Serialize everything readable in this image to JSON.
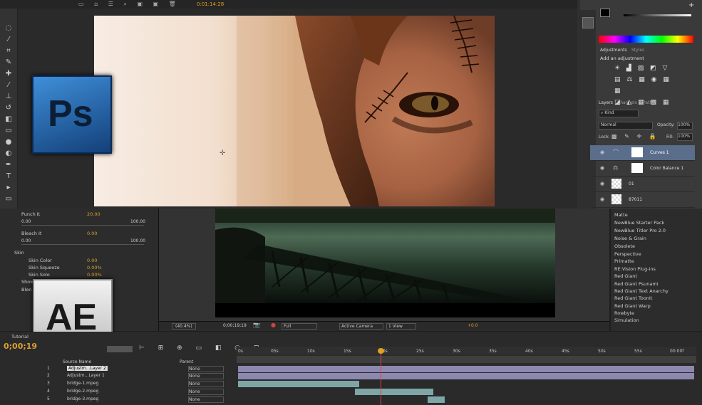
{
  "photoshop": {
    "logo": "Ps",
    "timecode": "0:01:14:28",
    "panels": {
      "adjustments_tab": "Adjustments",
      "styles_tab": "Styles",
      "add_adjustment": "Add an adjustment",
      "layers_tab": "Layers",
      "channels_tab": "Channels",
      "paths_tab": "Paths",
      "kind": "Kind",
      "blend_mode": "Normal",
      "opacity_label": "Opacity:",
      "opacity_value": "100%",
      "lock_label": "Lock:",
      "fill_label": "Fill:",
      "fill_value": "100%"
    },
    "layers": [
      {
        "name": "Curves 1"
      },
      {
        "name": "Color Balance 1"
      },
      {
        "name": "01"
      },
      {
        "name": "87011"
      }
    ]
  },
  "after_effects": {
    "logo": "AE",
    "effect_controls": {
      "punch_it": {
        "label": "Punch It",
        "value": "20.00",
        "min": "0.00",
        "max": "100.00"
      },
      "bleach_it": {
        "label": "Bleach It",
        "value": "0.00",
        "min": "0.00",
        "max": "100.00"
      },
      "skin": "Skin",
      "skin_color": {
        "label": "Skin Color",
        "value": "0.00"
      },
      "skin_squeeze": {
        "label": "Skin Squeeze",
        "value": "0.00%"
      },
      "skin_solo": {
        "label": "Skin Solo",
        "value": "0.00%"
      },
      "show": "Show",
      "blend": "Blen"
    },
    "viewer": {
      "zoom": "(40.4%)",
      "timecode": "0;00;19;19",
      "resolution": "Full",
      "camera": "Active Camera",
      "views": "1 View",
      "exposure": "+0.0"
    },
    "effects_list": [
      "Matte",
      "NewBlue Starter Pack",
      "NewBlue Titler Pro 2.0",
      "Noise & Grain",
      "Obsolete",
      "Perspective",
      "Primatte",
      "RE:Vision Plug-ins",
      "Red Giant",
      "Red Giant Psunami",
      "Red Giant Text Anarchy",
      "Red Giant ToonIt",
      "Red Giant Warp",
      "Rowbyte",
      "Simulation"
    ],
    "timeline": {
      "tab": "Tutorial",
      "current_time": "0;00;19",
      "source_name_header": "Source Name",
      "parent_header": "Parent",
      "ruler": [
        "0s",
        "05s",
        "10s",
        "15s",
        "20s",
        "25s",
        "30s",
        "35s",
        "40s",
        "45s",
        "50s",
        "55s",
        "00:00f"
      ],
      "layers": [
        {
          "num": "1",
          "name": "Adjustm...Layer 2",
          "parent": "None"
        },
        {
          "num": "2",
          "name": "Adjustm...Layer 1",
          "parent": "None"
        },
        {
          "num": "3",
          "name": "bridge-1.mpeg",
          "parent": "None"
        },
        {
          "num": "4",
          "name": "bridge-2.mpeg",
          "parent": "None"
        },
        {
          "num": "5",
          "name": "bridge-3.mpeg",
          "parent": "None"
        }
      ]
    }
  },
  "colors": {
    "ps_blue": "#2f7fd0",
    "ae_gray": "#d8d8d8",
    "playhead": "#e0a020",
    "track_purple": "#8c88b0",
    "track_teal": "#7fa6a6"
  }
}
